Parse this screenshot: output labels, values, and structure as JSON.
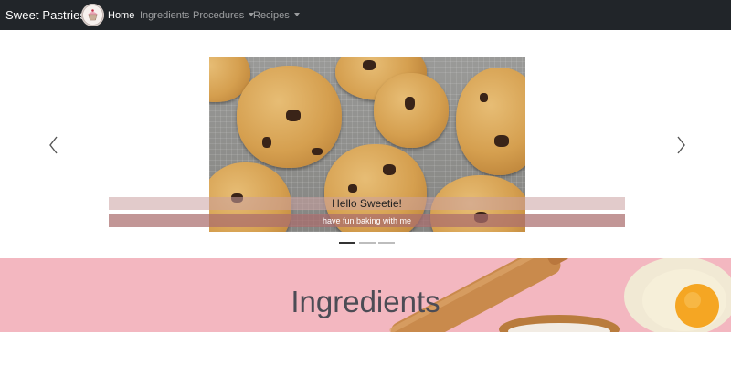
{
  "navbar": {
    "brand": "Sweet Pastries",
    "logo_icon": "cupcake-logo-icon",
    "links": [
      {
        "label": "Home",
        "active": true
      },
      {
        "label": "Ingredients",
        "active": false
      },
      {
        "label": "Procedures",
        "dropdown": true
      },
      {
        "label": "Recipes",
        "dropdown": true
      }
    ]
  },
  "carousel": {
    "slide_image": "chocolate-chip-cookies-image",
    "caption_title": "Hello Sweetie!",
    "caption_text": "have fun baking with me",
    "indicator_count": 3,
    "active_indicator": 0,
    "prev_icon": "chevron-left-icon",
    "next_icon": "chevron-right-icon"
  },
  "ingredients_section": {
    "heading": "Ingredients",
    "background_image": "rolling-pin-and-eggs-image"
  },
  "colors": {
    "navbar": "#212529",
    "banner": "#f3b7c0",
    "caption_bar_light": "#cba0a0",
    "caption_bar_dark": "#aa6e6e"
  }
}
